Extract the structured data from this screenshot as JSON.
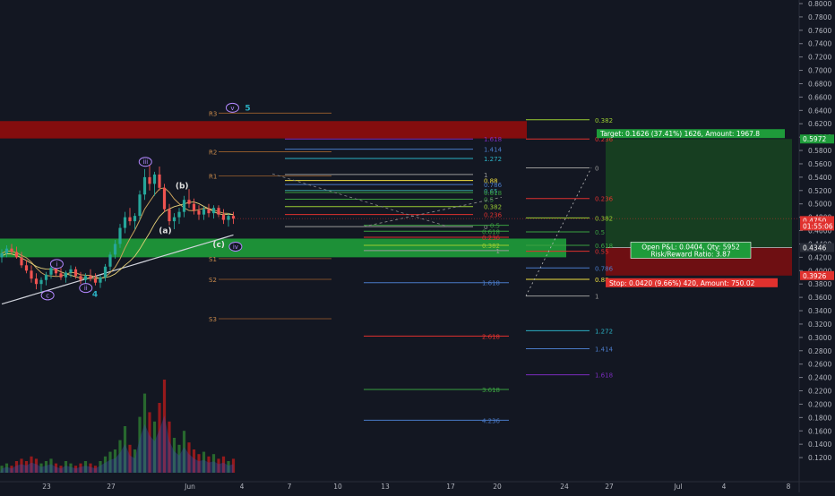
{
  "chart_data": {
    "type": "candlestick",
    "price_axis": {
      "min": 0.1,
      "max": 0.8,
      "step": 0.02,
      "labels": [
        "0.8000",
        "0.7800",
        "0.7600",
        "0.7400",
        "0.7200",
        "0.7000",
        "0.6800",
        "0.6600",
        "0.6400",
        "0.6200",
        "0.6000",
        "0.5800",
        "0.5600",
        "0.5400",
        "0.5200",
        "0.5000",
        "0.4800",
        "0.4600",
        "0.4400",
        "0.4200",
        "0.4000",
        "0.3800",
        "0.3600",
        "0.3400",
        "0.3200",
        "0.3000",
        "0.2800",
        "0.2600",
        "0.2400",
        "0.2200",
        "0.2000",
        "0.1800",
        "0.1600",
        "0.1400",
        "0.1200"
      ]
    },
    "time_axis": {
      "labels": [
        "23",
        "27",
        "Jun",
        "4",
        "7",
        "10",
        "13",
        "17",
        "20",
        "24",
        "27",
        "Jul",
        "4",
        "8"
      ]
    },
    "price_tags": [
      {
        "text": "0.5972",
        "value": 0.5972,
        "color": "#1e9b3a"
      },
      {
        "text": "0.4750",
        "value": 0.475,
        "color": "#e0312e"
      },
      {
        "text": "01:55:06",
        "value": 0.4668,
        "color": "#e0312e"
      },
      {
        "text": "0.4346",
        "value": 0.4346,
        "color": "#2a2e39"
      },
      {
        "text": "0.3926",
        "value": 0.3926,
        "color": "#e0312e"
      }
    ],
    "position": {
      "entry": 0.4346,
      "target": 0.5972,
      "stop": 0.3926,
      "target_label": "Target: 0.1626 (37.41%) 1626, Amount: 1967.8",
      "stop_label": "Stop: 0.0420 (9.66%) 420, Amount: 750.02",
      "pnl_label": "Open P&L: 0.0404, Qty: 5952",
      "rr_label": "Risk/Reward Ratio: 3.87"
    },
    "pivots": [
      {
        "name": "R3",
        "value": 0.636
      },
      {
        "name": "R2",
        "value": 0.578
      },
      {
        "name": "R1",
        "value": 0.542
      },
      {
        "name": "S1",
        "value": 0.418
      },
      {
        "name": "S2",
        "value": 0.387
      },
      {
        "name": "S3",
        "value": 0.328
      }
    ],
    "zones": [
      {
        "name": "resistance",
        "from": 0.598,
        "to": 0.624,
        "color": "#8e0d0d"
      },
      {
        "name": "support",
        "from": 0.42,
        "to": 0.448,
        "color": "#1e9b3a"
      }
    ],
    "fib_set_a": [
      {
        "label": "1.618",
        "value": 0.5972,
        "color": "#7b2cbf"
      },
      {
        "label": "1.414",
        "value": 0.582,
        "color": "#4a7ac7"
      },
      {
        "label": "1.272",
        "value": 0.568,
        "color": "#2bb0c4"
      },
      {
        "label": "1",
        "value": 0.544,
        "color": "#9a9a9a"
      },
      {
        "label": "0.88",
        "value": 0.535,
        "color": "#f0e040"
      },
      {
        "label": "0.786",
        "value": 0.529,
        "color": "#4a7ac7"
      },
      {
        "label": "0.65",
        "value": 0.52,
        "color": "#3aa0a0"
      },
      {
        "label": "0.618",
        "value": 0.517,
        "color": "#3aa040"
      },
      {
        "label": "0.5",
        "value": 0.507,
        "color": "#3aa040"
      },
      {
        "label": "0.382",
        "value": 0.496,
        "color": "#9acd32"
      },
      {
        "label": "0.236",
        "value": 0.484,
        "color": "#e0312e"
      },
      {
        "label": "0",
        "value": 0.466,
        "color": "#9a9a9a"
      }
    ],
    "fib_set_b": [
      {
        "label": "0.5",
        "value": 0.468,
        "color": "#3aa040"
      },
      {
        "label": "0.618",
        "value": 0.459,
        "color": "#3aa040"
      },
      {
        "label": "0.236",
        "value": 0.45,
        "color": "#e0312e"
      },
      {
        "label": "0.382",
        "value": 0.438,
        "color": "#9acd32"
      },
      {
        "label": "1",
        "value": 0.43,
        "color": "#9a9a9a"
      },
      {
        "label": "1.618",
        "value": 0.382,
        "color": "#4a7ac7"
      },
      {
        "label": "2.618",
        "value": 0.302,
        "color": "#e0312e"
      },
      {
        "label": "3.618",
        "value": 0.222,
        "color": "#3aa040"
      },
      {
        "label": "4.236",
        "value": 0.176,
        "color": "#4a7ac7"
      }
    ],
    "fib_set_c": [
      {
        "label": "0.382",
        "value": 0.626,
        "color": "#9acd32"
      },
      {
        "label": "0.236",
        "value": 0.5972,
        "color": "#e0312e"
      },
      {
        "label": "0",
        "value": 0.554,
        "color": "#9a9a9a"
      },
      {
        "label": "0.236",
        "value": 0.508,
        "color": "#e0312e"
      },
      {
        "label": "0.382",
        "value": 0.479,
        "color": "#9acd32"
      },
      {
        "label": "0.5",
        "value": 0.458,
        "color": "#3aa040"
      },
      {
        "label": "0.618",
        "value": 0.438,
        "color": "#3aa040"
      },
      {
        "label": "0.55",
        "value": 0.429,
        "color": "#e0312e"
      },
      {
        "label": "0.786",
        "value": 0.404,
        "color": "#4a7ac7"
      },
      {
        "label": "0.88",
        "value": 0.387,
        "color": "#f0e040"
      },
      {
        "label": "1",
        "value": 0.362,
        "color": "#9a9a9a"
      },
      {
        "label": "1.272",
        "value": 0.31,
        "color": "#2bb0c4"
      },
      {
        "label": "1.414",
        "value": 0.283,
        "color": "#4a7ac7"
      },
      {
        "label": "1.618",
        "value": 0.244,
        "color": "#7b2cbf"
      }
    ],
    "wave_labels": [
      {
        "text": "v",
        "style": "circle",
        "color": "#b388ff",
        "t": 15.1,
        "price": 0.644
      },
      {
        "text": "5",
        "style": "plain",
        "color": "#2bb0c4",
        "t": 16.1,
        "price": 0.644
      },
      {
        "text": "iii",
        "style": "circle",
        "color": "#b388ff",
        "t": 9.4,
        "price": 0.563
      },
      {
        "text": "(b)",
        "style": "plain",
        "color": "#e0e0e0",
        "t": 11.8,
        "price": 0.527
      },
      {
        "text": "(a)",
        "style": "plain",
        "color": "#e0e0e0",
        "t": 10.7,
        "price": 0.46
      },
      {
        "text": "(c)",
        "style": "plain",
        "color": "#e0e0e0",
        "t": 14.2,
        "price": 0.439
      },
      {
        "text": "iv",
        "style": "circle",
        "color": "#b388ff",
        "t": 15.3,
        "price": 0.436
      },
      {
        "text": "i",
        "style": "circle",
        "color": "#b388ff",
        "t": 3.6,
        "price": 0.41
      },
      {
        "text": "ii",
        "style": "circle",
        "color": "#b388ff",
        "t": 5.5,
        "price": 0.374
      },
      {
        "text": "4",
        "style": "plain",
        "color": "#2bb0c4",
        "t": 6.1,
        "price": 0.365
      },
      {
        "text": "c",
        "style": "circle",
        "color": "#b388ff",
        "t": 3.0,
        "price": 0.363
      }
    ],
    "candles": [
      [
        0.42,
        0.432,
        0.412,
        0.426
      ],
      [
        0.426,
        0.438,
        0.42,
        0.433
      ],
      [
        0.433,
        0.44,
        0.424,
        0.428
      ],
      [
        0.428,
        0.436,
        0.418,
        0.42
      ],
      [
        0.42,
        0.428,
        0.404,
        0.408
      ],
      [
        0.408,
        0.416,
        0.396,
        0.4
      ],
      [
        0.4,
        0.408,
        0.382,
        0.388
      ],
      [
        0.388,
        0.396,
        0.372,
        0.38
      ],
      [
        0.38,
        0.39,
        0.368,
        0.386
      ],
      [
        0.386,
        0.398,
        0.378,
        0.394
      ],
      [
        0.394,
        0.41,
        0.388,
        0.404
      ],
      [
        0.404,
        0.412,
        0.392,
        0.396
      ],
      [
        0.396,
        0.404,
        0.386,
        0.39
      ],
      [
        0.39,
        0.4,
        0.382,
        0.397
      ],
      [
        0.397,
        0.408,
        0.39,
        0.402
      ],
      [
        0.402,
        0.406,
        0.388,
        0.392
      ],
      [
        0.392,
        0.398,
        0.38,
        0.386
      ],
      [
        0.386,
        0.396,
        0.378,
        0.392
      ],
      [
        0.392,
        0.402,
        0.384,
        0.388
      ],
      [
        0.388,
        0.396,
        0.378,
        0.382
      ],
      [
        0.382,
        0.394,
        0.374,
        0.39
      ],
      [
        0.39,
        0.41,
        0.384,
        0.406
      ],
      [
        0.406,
        0.428,
        0.4,
        0.424
      ],
      [
        0.424,
        0.446,
        0.418,
        0.44
      ],
      [
        0.44,
        0.47,
        0.434,
        0.464
      ],
      [
        0.464,
        0.488,
        0.456,
        0.48
      ],
      [
        0.48,
        0.494,
        0.468,
        0.474
      ],
      [
        0.474,
        0.486,
        0.462,
        0.482
      ],
      [
        0.482,
        0.52,
        0.476,
        0.514
      ],
      [
        0.514,
        0.552,
        0.506,
        0.54
      ],
      [
        0.54,
        0.562,
        0.52,
        0.53
      ],
      [
        0.53,
        0.548,
        0.512,
        0.544
      ],
      [
        0.544,
        0.556,
        0.52,
        0.524
      ],
      [
        0.524,
        0.53,
        0.488,
        0.492
      ],
      [
        0.492,
        0.5,
        0.468,
        0.474
      ],
      [
        0.474,
        0.486,
        0.462,
        0.48
      ],
      [
        0.48,
        0.494,
        0.47,
        0.488
      ],
      [
        0.488,
        0.512,
        0.48,
        0.506
      ],
      [
        0.506,
        0.522,
        0.494,
        0.5
      ],
      [
        0.5,
        0.508,
        0.484,
        0.49
      ],
      [
        0.49,
        0.498,
        0.476,
        0.484
      ],
      [
        0.484,
        0.496,
        0.476,
        0.492
      ],
      [
        0.492,
        0.5,
        0.48,
        0.486
      ],
      [
        0.486,
        0.498,
        0.478,
        0.494
      ],
      [
        0.494,
        0.498,
        0.48,
        0.484
      ],
      [
        0.484,
        0.492,
        0.47,
        0.476
      ],
      [
        0.476,
        0.486,
        0.466,
        0.482
      ],
      [
        0.482,
        0.488,
        0.47,
        0.478
      ]
    ],
    "volume": [
      3,
      4,
      3,
      5,
      6,
      5,
      7,
      6,
      4,
      5,
      6,
      4,
      3,
      5,
      4,
      3,
      4,
      5,
      4,
      3,
      5,
      7,
      9,
      10,
      14,
      20,
      12,
      10,
      24,
      34,
      26,
      22,
      30,
      40,
      22,
      15,
      12,
      18,
      13,
      10,
      8,
      9,
      7,
      8,
      6,
      7,
      5,
      6
    ]
  }
}
